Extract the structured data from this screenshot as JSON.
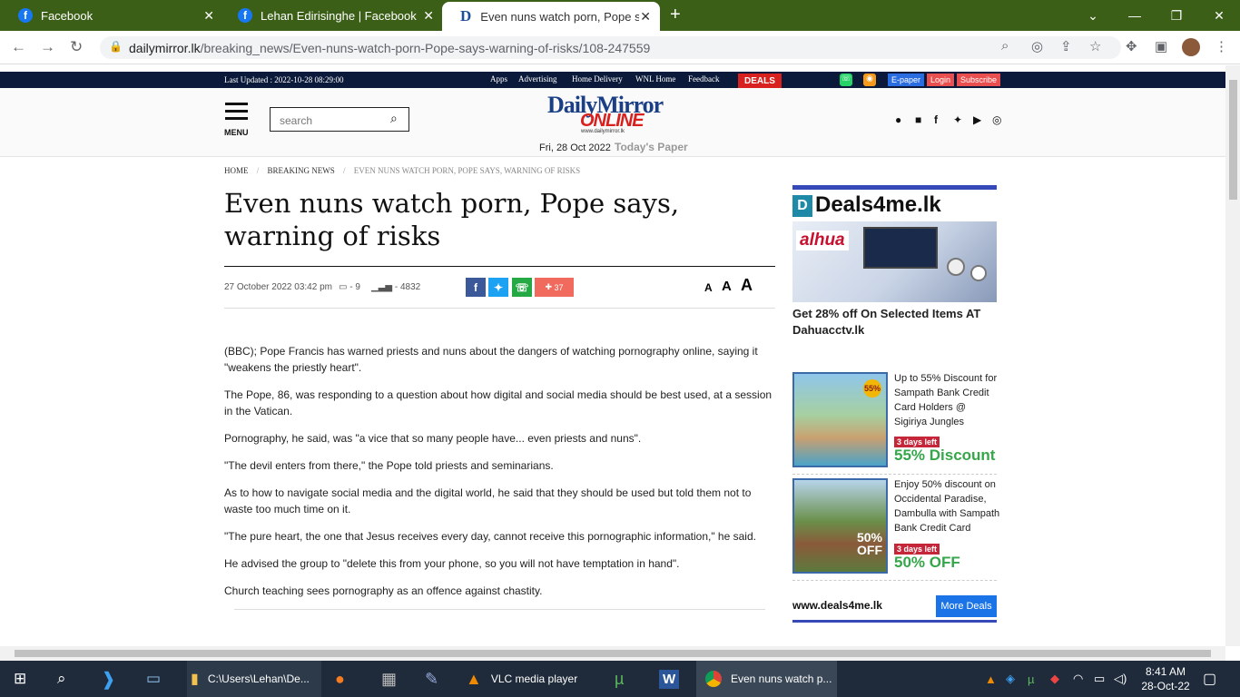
{
  "browser": {
    "tabs": [
      {
        "label": "Facebook",
        "icon": "facebook-icon"
      },
      {
        "label": "Lehan Edirisinghe | Facebook",
        "icon": "facebook-icon"
      },
      {
        "label": "Even nuns watch porn, Pope says",
        "icon": "dailymirror-icon"
      }
    ],
    "url_domain": "dailymirror.lk",
    "url_path": "/breaking_news/Even-nuns-watch-porn-Pope-says-warning-of-risks/108-247559"
  },
  "site": {
    "last_updated": "Last Updated : 2022-10-28 08:29:00",
    "top_links": [
      "Apps",
      "Advertising",
      "Home Delivery",
      "WNL Home",
      "Feedback"
    ],
    "deals_badge": "DEALS",
    "epaper": "E-paper",
    "login": "Login",
    "subscribe": "Subscribe",
    "menu_label": "MENU",
    "search_placeholder": "search",
    "logo_top": "DailyMirror",
    "logo_bottom": "ONLINE",
    "logo_url": "www.dailymirror.lk",
    "date": "Fri, 28 Oct 2022",
    "todays_paper": "Today's Paper"
  },
  "article": {
    "breadcrumb": [
      "HOME",
      "BREAKING NEWS",
      "EVEN NUNS WATCH PORN, POPE SAYS, WARNING OF RISKS"
    ],
    "title": "Even nuns watch porn, Pope says, warning of risks",
    "date": "27 October 2022 03:42 pm",
    "comments": "- 9",
    "views": "- 4832",
    "share_count": "37",
    "paragraphs": [
      "(BBC); Pope Francis has warned priests and nuns about the dangers of watching pornography online, saying it \"weakens the priestly heart\".",
      "The Pope, 86, was responding to a question about how digital and social media should be best used, at a session in the Vatican.",
      "Pornography, he said, was \"a vice that so many people have... even priests and nuns\".",
      "\"The devil enters from there,\" the Pope told priests and seminarians.",
      "As to how to navigate social media and the digital world, he said that they should be used but told them not to waste too much time on it.",
      "\"The pure heart, the one that Jesus receives every day, cannot receive this pornographic information,\" he said.",
      "He advised the group to \"delete this from your phone, so you will not have temptation in hand\".",
      "Church teaching sees pornography as an offence against chastity."
    ]
  },
  "sidebar": {
    "brand": "Deals4me.lk",
    "banner_brand": "alhua",
    "banner_caption": "Get 28% off On Selected Items AT Dahuacctv.lk",
    "deals": [
      {
        "text": "Up to 55% Discount for Sampath Bank Credit Card Holders @ Sigiriya Jungles",
        "days": "3 days left",
        "discount": "55% Discount",
        "img_badge": "55%"
      },
      {
        "text": "Enjoy 50% discount on Occidental Paradise, Dambulla with Sampath Bank Credit Card",
        "days": "3 days left",
        "discount": "50% OFF",
        "img_badge": "50% OFF"
      }
    ],
    "site_url": "www.deals4me.lk",
    "more_deals": "More Deals"
  },
  "taskbar": {
    "explorer": "C:\\Users\\Lehan\\De...",
    "vlc": "VLC media player",
    "chrome": "Even nuns watch p...",
    "time": "8:41 AM",
    "date": "28-Oct-22"
  },
  "colors": {
    "tabstrip": "#3b5f16",
    "site_topbar": "#0b1a3a",
    "deals_accent": "#3549b8",
    "discount_green": "#36a64a"
  }
}
